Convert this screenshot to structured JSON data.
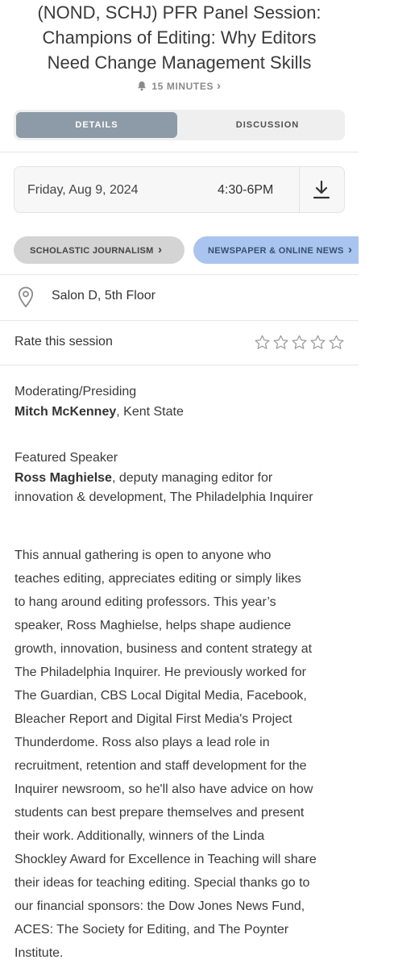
{
  "session": {
    "title_lines": [
      "(NOND, SCHJ) PFR Panel Session:",
      "Champions of Editing: Why Editors",
      "Need Change Management Skills"
    ],
    "duration": "15 MINUTES",
    "duration_chevron": "›"
  },
  "tabs": [
    {
      "label": "DETAILS",
      "active": true
    },
    {
      "label": "DISCUSSION",
      "active": false
    }
  ],
  "schedule": {
    "date": "Friday, Aug 9, 2024",
    "time": "4:30-6PM",
    "download_icon": "download-icon"
  },
  "tracks": [
    {
      "label": "SCHOLASTIC JOURNALISM",
      "chevron": "›",
      "color": "#d4d4d4"
    },
    {
      "label": "NEWSPAPER & ONLINE NEWS",
      "chevron": "›",
      "color": "#a9c5ef"
    }
  ],
  "location": {
    "label": "Salon D, 5th Floor",
    "icon": "location-pin-icon"
  },
  "rating": {
    "label": "Rate this session",
    "max_stars": 5,
    "value": 0
  },
  "moderator": {
    "role": "Moderating/Presiding",
    "name": "Mitch McKenney",
    "affiliation": ", Kent State"
  },
  "speaker": {
    "role": "Featured Speaker",
    "name": "Ross Maghielse",
    "affiliation_line1": ", deputy managing editor for",
    "affiliation_line2": "innovation & development, The Philadelphia Inquirer"
  },
  "description_lines": [
    "This annual gathering is open to anyone who",
    "teaches editing, appreciates editing or simply likes",
    "to hang around editing professors. This year’s",
    "speaker, Ross Maghielse, helps shape audience",
    "growth, innovation, business and content strategy at",
    "The Philadelphia Inquirer. He previously worked for",
    "The Guardian, CBS Local Digital Media, Facebook,",
    "Bleacher Report and Digital First Media's Project",
    "Thunderdome. Ross also plays a lead role in",
    "recruitment, retention and staff development for the",
    "Inquirer newsroom, so he'll also have advice on how",
    "students can best prepare themselves and present",
    "their work. Additionally, winners of the Linda",
    "Shockley Award for Excellence in Teaching will share",
    "their ideas for teaching editing. Special thanks go to",
    "our financial sponsors: the Dow Jones News Fund,",
    "ACES: The Society for Editing, and The Poynter",
    "Institute."
  ],
  "colors": {
    "active_tab": "#8d9aa7",
    "chip_blue": "#a9c5ef",
    "chip_gray": "#d4d4d4"
  }
}
